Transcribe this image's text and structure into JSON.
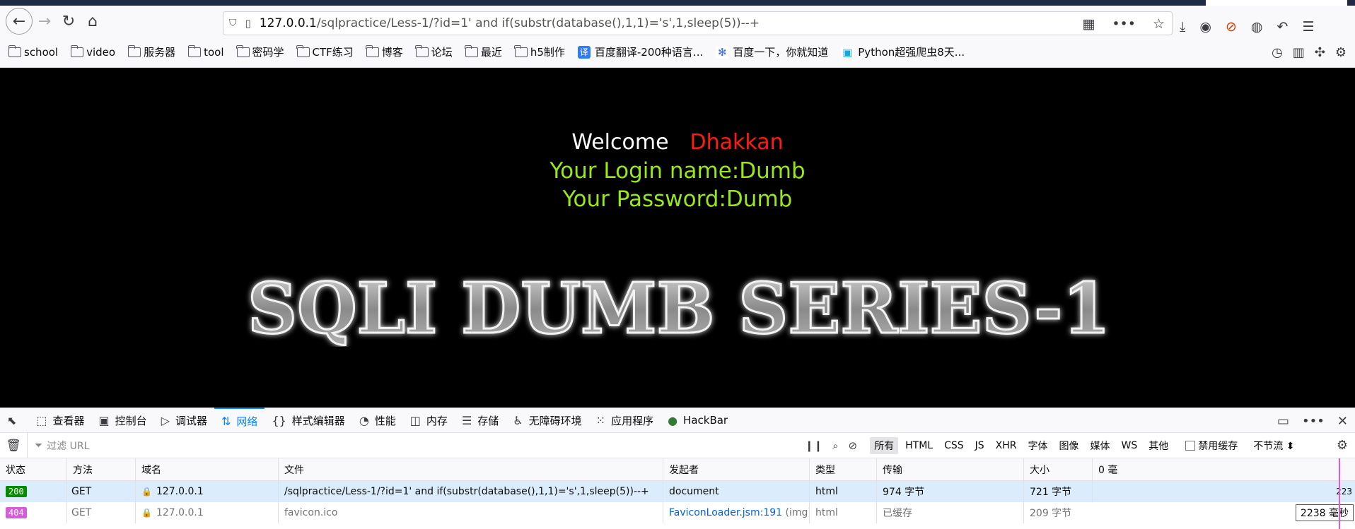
{
  "browser": {
    "url_host": "127.0.0.1",
    "url_path": "/sqlpractice/Less-1/?id=1' and if(substr(database(),1,1)='s',1,sleep(5))--+"
  },
  "bookmarks": [
    {
      "label": "school",
      "type": "folder"
    },
    {
      "label": "video",
      "type": "folder"
    },
    {
      "label": "服务器",
      "type": "folder"
    },
    {
      "label": "tool",
      "type": "folder"
    },
    {
      "label": "密码学",
      "type": "folder"
    },
    {
      "label": "CTF练习",
      "type": "folder"
    },
    {
      "label": "博客",
      "type": "folder"
    },
    {
      "label": "论坛",
      "type": "folder"
    },
    {
      "label": "最近",
      "type": "folder"
    },
    {
      "label": "h5制作",
      "type": "folder"
    },
    {
      "label": "百度翻译-200种语言...",
      "type": "site",
      "icon": "译",
      "color": "#2d7cf6"
    },
    {
      "label": "百度一下，你就知道",
      "type": "site",
      "icon": "✻",
      "color": "#3b6be0"
    },
    {
      "label": "Python超强爬虫8天...",
      "type": "site",
      "icon": "▣",
      "color": "#11a7e0"
    }
  ],
  "page": {
    "welcome": "Welcome",
    "name": "Dhakkan",
    "login": "Your Login name:Dumb",
    "password": "Your Password:Dumb",
    "banner": "SQLI DUMB SERIES-1"
  },
  "devtools": {
    "tabs": [
      {
        "label": "查看器",
        "icon": "⬚"
      },
      {
        "label": "控制台",
        "icon": "▣"
      },
      {
        "label": "调试器",
        "icon": "▷"
      },
      {
        "label": "网络",
        "icon": "⇅",
        "active": true
      },
      {
        "label": "样式编辑器",
        "icon": "{}"
      },
      {
        "label": "性能",
        "icon": "◔"
      },
      {
        "label": "内存",
        "icon": "◫"
      },
      {
        "label": "存储",
        "icon": "☰"
      },
      {
        "label": "无障碍环境",
        "icon": "♿"
      },
      {
        "label": "应用程序",
        "icon": "⁙"
      },
      {
        "label": "HackBar",
        "icon": "●"
      }
    ],
    "filter_placeholder": "过滤 URL",
    "type_filters": [
      "所有",
      "HTML",
      "CSS",
      "JS",
      "XHR",
      "字体",
      "图像",
      "媒体",
      "WS",
      "其他"
    ],
    "disable_cache": "禁用缓存",
    "throttle": "不节流",
    "columns": [
      "状态",
      "方法",
      "域名",
      "文件",
      "发起者",
      "类型",
      "传输",
      "大小"
    ],
    "waterfall_header": "0 毫",
    "rows": [
      {
        "status": "200",
        "method": "GET",
        "domain": "127.0.0.1",
        "file": "/sqlpractice/Less-1/?id=1' and if(substr(database(),1,1)='s',1,sleep(5))--+",
        "initiator": "document",
        "initiator_extra": "",
        "type": "html",
        "transferred": "974 字节",
        "size": "721 字节",
        "waterfall": "223"
      },
      {
        "status": "404",
        "method": "GET",
        "domain": "127.0.0.1",
        "file": "favicon.ico",
        "initiator": "FaviconLoader.jsm:191",
        "initiator_extra": "(img)",
        "type": "html",
        "transferred": "已缓存",
        "size": "209 字节",
        "waterfall": "2238 毫秒"
      }
    ]
  }
}
